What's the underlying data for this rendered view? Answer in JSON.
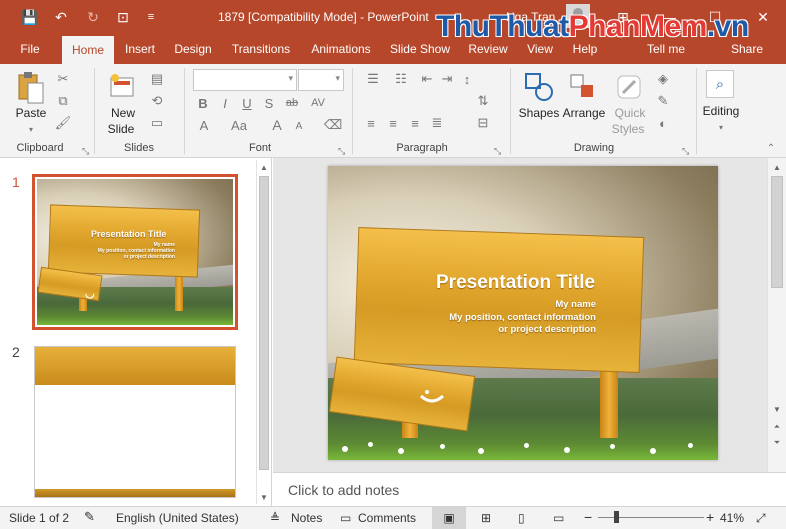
{
  "titlebar": {
    "title": "1879 [Compatibility Mode]  -  PowerPoint",
    "user": "Nga Tran",
    "watermark_part1": "ThuThuat",
    "watermark_part2": "PhanMem",
    "watermark_part3": ".vn",
    "qa_save": "💾",
    "qa_undo": "↶",
    "qa_redo": "↻",
    "qa_present": "⊡",
    "qa_customize": "≡",
    "ribbon_display": "⊞",
    "minimize": "—",
    "restore": "☐",
    "close": "✕"
  },
  "tabs": [
    "File",
    "Home",
    "Insert",
    "Design",
    "Transitions",
    "Animations",
    "Slide Show",
    "Review",
    "View",
    "Help",
    "Tell me",
    "Share"
  ],
  "ribbon": {
    "clipboard": {
      "paste": "Paste",
      "label": "Clipboard"
    },
    "slides": {
      "new_slide_line1": "New",
      "new_slide_line2": "Slide",
      "label": "Slides"
    },
    "font": {
      "bold": "B",
      "italic": "I",
      "underline": "U",
      "strike": "S",
      "shadow": "ab",
      "spacing": "AV",
      "font_color": "A",
      "change_case": "Aa",
      "grow": "A",
      "shrink": "A",
      "label": "Font"
    },
    "paragraph": {
      "label": "Paragraph"
    },
    "drawing": {
      "shapes": "Shapes",
      "arrange": "Arrange",
      "quick_styles_line1": "Quick",
      "quick_styles_line2": "Styles",
      "label": "Drawing"
    },
    "editing": {
      "label": "Editing"
    }
  },
  "slides_pane": {
    "slides": [
      {
        "number": "1",
        "title": "Presentation Title",
        "sub1": "My name",
        "sub2": "My position, contact information",
        "sub3": "or project description"
      },
      {
        "number": "2"
      }
    ]
  },
  "main_slide": {
    "title": "Presentation Title",
    "sub1": "My name",
    "sub2": "My position, contact information",
    "sub3": "or project description"
  },
  "notes": {
    "placeholder": "Click to add notes"
  },
  "status": {
    "slide_counter": "Slide 1 of 2",
    "language": "English (United States)",
    "notes": "Notes",
    "comments": "Comments",
    "zoom_minus": "−",
    "zoom_plus": "+",
    "zoom_level": "41%",
    "zoom_fraction": 0.41
  },
  "colors": {
    "accent": "#b7472a",
    "ribbon_bg": "#f3f3f3",
    "selected_thumb_border": "#d35230"
  }
}
